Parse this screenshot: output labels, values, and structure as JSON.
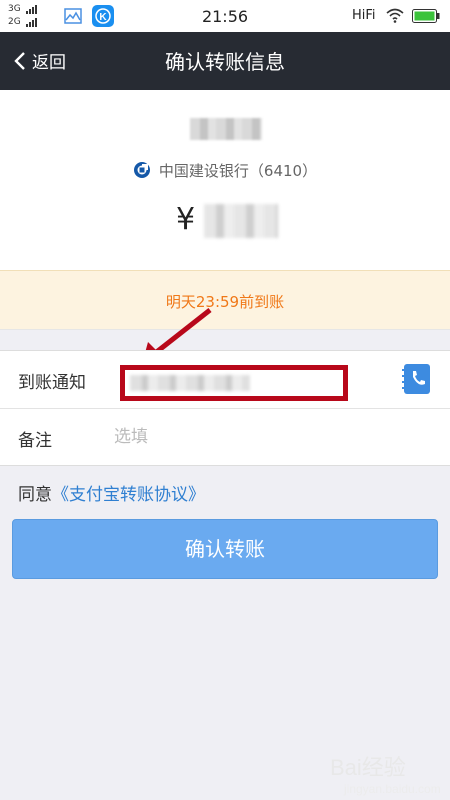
{
  "status_bar": {
    "signal1_label": "3G",
    "signal2_label": "2G",
    "time": "21:56",
    "hifi": "HiFi"
  },
  "nav": {
    "back_label": "返回",
    "title": "确认转账信息"
  },
  "summary": {
    "bank": "中国建设银行（6410）",
    "amount_prefix": "¥"
  },
  "notice": {
    "text": "明天23:59前到账"
  },
  "form": {
    "notify_label": "到账通知",
    "notify_value": "",
    "remark_label": "备注",
    "remark_placeholder": "选填"
  },
  "agreement": {
    "prefix": "同意",
    "link": "《支付宝转账协议》"
  },
  "confirm_button": "确认转账",
  "watermark": {
    "main": "Bai经验",
    "sub": "jingyan.baidu.com"
  },
  "colors": {
    "navbar": "#272b33",
    "notice_text": "#f07818",
    "link": "#2f7fd1",
    "button": "#6aaaf0",
    "annotation": "#b8081a"
  }
}
